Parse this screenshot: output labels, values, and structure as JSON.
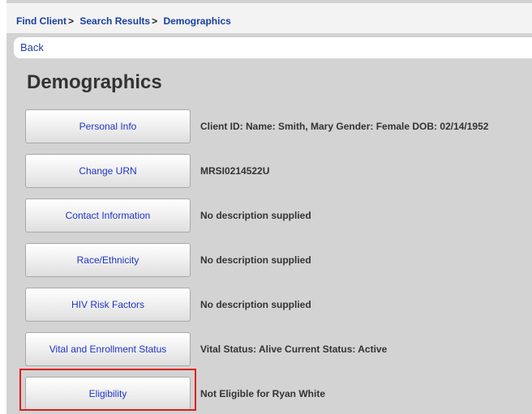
{
  "breadcrumb": {
    "items": [
      "Find Client",
      "Search Results",
      "Demographics"
    ],
    "separator": ">"
  },
  "back_label": "Back",
  "page_title": "Demographics",
  "sections": [
    {
      "label": "Personal Info",
      "description": "Client ID: Name: Smith, Mary Gender: Female DOB: 02/14/1952"
    },
    {
      "label": "Change URN",
      "description": "MRSI0214522U"
    },
    {
      "label": "Contact Information",
      "description": "No description supplied"
    },
    {
      "label": "Race/Ethnicity",
      "description": "No description supplied"
    },
    {
      "label": "HIV Risk Factors",
      "description": "No description supplied"
    },
    {
      "label": "Vital and Enrollment Status",
      "description": "Vital Status: Alive Current Status: Active"
    },
    {
      "label": "Eligibility",
      "description": "Not Eligible for Ryan White",
      "highlighted": true
    }
  ],
  "colors": {
    "link": "#1a3fa3",
    "button_text": "#1f35c9",
    "highlight": "#e01b1b",
    "panel_bg": "#d3d3d3"
  }
}
